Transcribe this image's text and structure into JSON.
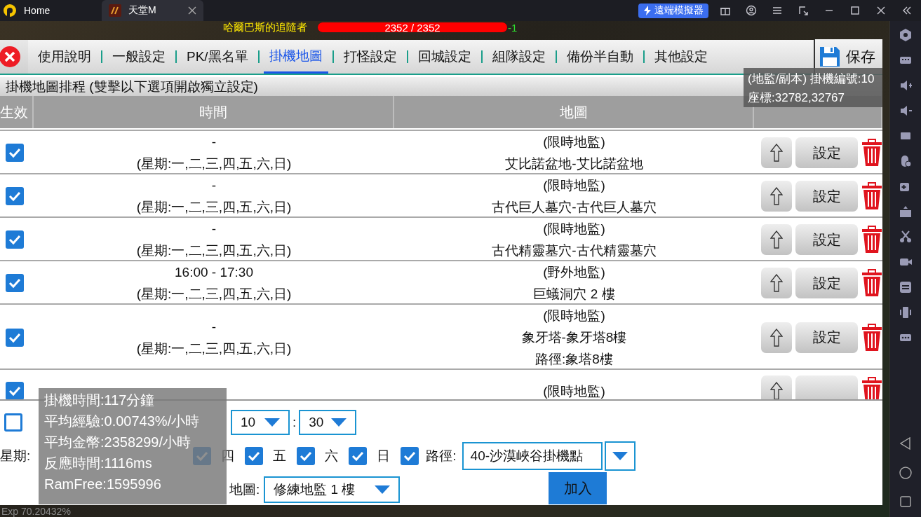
{
  "emulator": {
    "tabs": [
      {
        "label": "Home",
        "selected": false
      },
      {
        "label": "天堂M",
        "selected": true
      }
    ],
    "remote_button": "遠端模擬器"
  },
  "game": {
    "target_name": "哈爾巴斯的追隨者",
    "hp": {
      "level": 1,
      "reading": "2352 / 2352"
    },
    "hp_change": "-1",
    "exp": "Exp 70.20432%"
  },
  "dialog": {
    "tabs": [
      {
        "label": "使用說明",
        "selected": false
      },
      {
        "label": "一般設定",
        "selected": false
      },
      {
        "label": "PK/黑名單",
        "selected": false
      },
      {
        "label": "掛機地圖",
        "selected": true
      },
      {
        "label": "打怪設定",
        "selected": false
      },
      {
        "label": "回城設定",
        "selected": false
      },
      {
        "label": "組隊設定",
        "selected": false
      },
      {
        "label": "備份半自動",
        "selected": false
      },
      {
        "label": "其他設定",
        "selected": false
      }
    ],
    "save_button": "保存",
    "info": [
      "(地監/副本) 掛機編號:10",
      "座標:32782,32767"
    ],
    "section_title": "掛機地圖排程 (雙擊以下選項開啟獨立設定)",
    "table": {
      "columns": [
        "生效",
        "時間",
        "地圖"
      ],
      "rows": [
        {
          "enabled": true,
          "time": [
            "-",
            "(星期:一,二,三,四,五,六,日)"
          ],
          "map": [
            "(限時地監)",
            "艾比諾盆地-艾比諾盆地"
          ],
          "setting_button": "設定"
        },
        {
          "enabled": true,
          "time": [
            "-",
            "(星期:一,二,三,四,五,六,日)"
          ],
          "map": [
            "(限時地監)",
            "古代巨人墓穴-古代巨人墓穴"
          ],
          "setting_button": "設定"
        },
        {
          "enabled": true,
          "time": [
            "-",
            "(星期:一,二,三,四,五,六,日)"
          ],
          "map": [
            "(限時地監)",
            "古代精靈墓穴-古代精靈墓穴"
          ],
          "setting_button": "設定"
        },
        {
          "enabled": true,
          "time": [
            "16:00 - 17:30",
            "(星期:一,二,三,四,五,六,日)"
          ],
          "map": [
            "(野外地監)",
            "巨蟻洞穴 2 樓"
          ],
          "setting_button": "設定"
        },
        {
          "enabled": true,
          "time": [
            "-",
            "(星期:一,二,三,四,五,六,日)"
          ],
          "map": [
            "(限時地監)",
            "象牙塔-象牙塔8樓",
            "路徑:象塔8樓"
          ],
          "setting_button": "設定"
        },
        {
          "enabled": true,
          "time": [],
          "map": [
            "(限時地監)"
          ]
        }
      ]
    },
    "form": {
      "time_filter": {
        "checked": false
      },
      "end_hour": "10",
      "separator": ":",
      "end_minute": "30",
      "weekday_label": "星期:",
      "weekdays": [
        {
          "label": "四",
          "checked": true
        },
        {
          "label": "五",
          "checked": true
        },
        {
          "label": "六",
          "checked": true
        },
        {
          "label": "日",
          "checked": true
        }
      ],
      "path_enabled": true,
      "path_label": "路徑:",
      "path": "40-沙漠峽谷掛機點",
      "map_label": "地圖:",
      "map": "修練地監 1 樓",
      "add_button": "加入"
    },
    "stats": [
      "掛機時間:117分鐘",
      "平均經驗:0.00743%/小時",
      "平均金幣:2358299/小時",
      "反應時間:1116ms",
      "RamFree:1595996"
    ]
  }
}
